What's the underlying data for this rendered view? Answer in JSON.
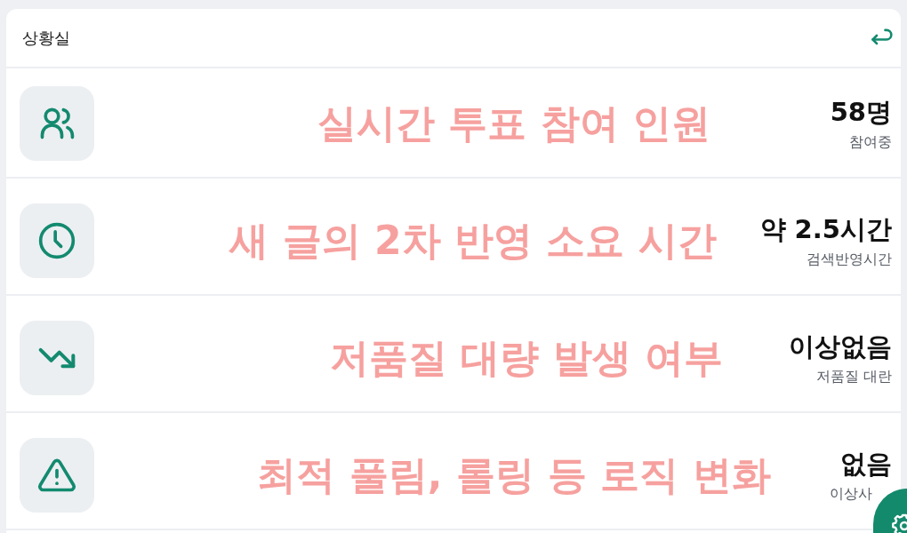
{
  "header": {
    "title": "상황실"
  },
  "rows": [
    {
      "annotation": "실시간 투표 참여 인원",
      "value": "58명",
      "caption": "참여중"
    },
    {
      "annotation": "새 글의 2차 반영 소요 시간",
      "value": "약 2.5시간",
      "caption": "검색반영시간"
    },
    {
      "annotation": "저품질 대량 발생 여부",
      "value": "이상없음",
      "caption": "저품질 대란"
    },
    {
      "annotation": "최적 풀림, 롤링 등 로직 변화",
      "value": "없음",
      "caption": "이상사"
    }
  ]
}
